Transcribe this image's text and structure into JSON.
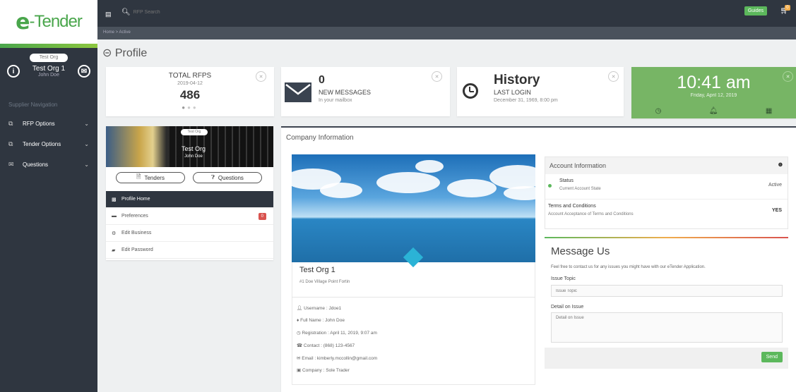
{
  "sidebar": {
    "logo_prefix": "e",
    "logo_text": "-Tender",
    "org_pill": "Test Org",
    "user_name": "Test Org 1",
    "user_sub": "John Doe",
    "nav_label": "Supplier Navigation",
    "items": [
      {
        "label": "RFP Options"
      },
      {
        "label": "Tender Options"
      },
      {
        "label": "Questions"
      }
    ]
  },
  "topbar": {
    "search_placeholder": "RFP Search",
    "guides_label": "Guides",
    "cart_count": "0"
  },
  "breadcrumb": "Home  >  Active",
  "page_title": "Profile",
  "stats": {
    "rfps": {
      "title": "TOTAL RFPS",
      "date": "2019-04-12",
      "value": "486"
    },
    "messages": {
      "value": "0",
      "label": "NEW MESSAGES",
      "sub": "In your mailbox"
    },
    "history": {
      "title": "History",
      "label": "LAST LOGIN",
      "sub": "December 31, 1969, 8:00 pm"
    },
    "time": {
      "value": "10:41 am",
      "date": "Friday, April 12, 2019"
    }
  },
  "profile_card": {
    "pill": "Test Org",
    "name": "Test Org",
    "sub": "John Doe",
    "tenders_label": "Tenders",
    "questions_label": "Questions",
    "menu": [
      {
        "label": "Profile Home"
      },
      {
        "label": "Preferences",
        "badge": "0"
      },
      {
        "label": "Edit Business"
      },
      {
        "label": "Edit Password"
      }
    ]
  },
  "company": {
    "heading": "Company Information",
    "name": "Test Org 1",
    "address": "#1 Doe Village Point Fortin",
    "details": [
      "Username : Jdoe1",
      "Full Name : John Doe",
      "Registration : April 11, 2019, 9:07 am",
      "Contact : (868) 123-4567",
      "Email : kimberly.mccollin@gmail.com",
      "Company : Sole Trader"
    ]
  },
  "account": {
    "heading": "Account Information",
    "status_label": "Status",
    "status_sub": "Current Account State",
    "status_value": "Active",
    "terms_label": "Terms and Conditions",
    "terms_sub": "Account Acceptance of Terms and Conditions",
    "terms_value": "YES"
  },
  "message_us": {
    "title": "Message Us",
    "desc": "Feel free to contact us for any issues you might have with our eTender Application.",
    "topic_label": "Issue Topic",
    "topic_placeholder": "Issue Topic",
    "detail_label": "Detail on Issue",
    "detail_placeholder": "Detail on Issue",
    "send_label": "Send"
  }
}
